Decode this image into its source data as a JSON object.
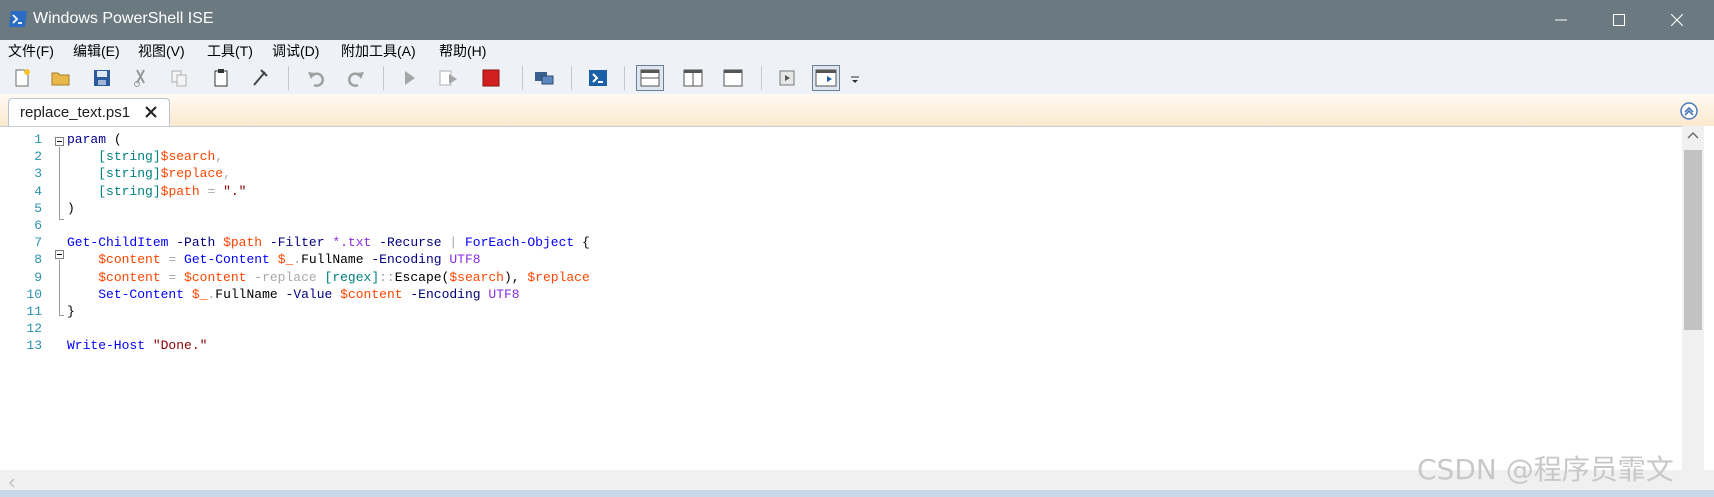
{
  "window": {
    "title": "Windows PowerShell ISE",
    "controls": [
      "minimize-icon",
      "maximize-icon",
      "close-icon"
    ]
  },
  "menu": {
    "items": [
      {
        "label": "文件(F)"
      },
      {
        "label": "编辑(E)"
      },
      {
        "label": "视图(V)"
      },
      {
        "label": "工具(T)"
      },
      {
        "label": "调试(D)"
      },
      {
        "label": "附加工具(A)"
      },
      {
        "label": "帮助(H)"
      }
    ]
  },
  "toolbar": {
    "buttons": [
      "new-file-icon",
      "open-folder-icon",
      "save-icon",
      "cut-icon",
      "copy-icon",
      "paste-icon",
      "clear-console-icon",
      "undo-icon",
      "redo-icon",
      "run-script-icon",
      "run-selection-icon",
      "stop-icon",
      "new-remote-tab-icon",
      "powershell-console-icon",
      "show-script-top-icon",
      "show-script-right-icon",
      "show-script-maximized-icon",
      "show-commands-icon",
      "show-addon-icon",
      "overflow-icon"
    ]
  },
  "tab": {
    "label": "replace_text.ps1"
  },
  "editor": {
    "lines": [
      {
        "n": "1",
        "tokens": [
          {
            "t": "param",
            "c": "kw"
          },
          {
            "t": " (",
            "c": "plain"
          }
        ]
      },
      {
        "n": "2",
        "tokens": [
          {
            "t": "    ",
            "c": "plain"
          },
          {
            "t": "[string]",
            "c": "type"
          },
          {
            "t": "$search",
            "c": "var"
          },
          {
            "t": ",",
            "c": "op"
          }
        ]
      },
      {
        "n": "3",
        "tokens": [
          {
            "t": "    ",
            "c": "plain"
          },
          {
            "t": "[string]",
            "c": "type"
          },
          {
            "t": "$replace",
            "c": "var"
          },
          {
            "t": ",",
            "c": "op"
          }
        ]
      },
      {
        "n": "4",
        "tokens": [
          {
            "t": "    ",
            "c": "plain"
          },
          {
            "t": "[string]",
            "c": "type"
          },
          {
            "t": "$path",
            "c": "var"
          },
          {
            "t": " = ",
            "c": "op"
          },
          {
            "t": "\".\"",
            "c": "str"
          }
        ]
      },
      {
        "n": "5",
        "tokens": [
          {
            "t": ")",
            "c": "plain"
          }
        ]
      },
      {
        "n": "6",
        "tokens": []
      },
      {
        "n": "7",
        "tokens": [
          {
            "t": "Get-ChildItem",
            "c": "cmd"
          },
          {
            "t": " ",
            "c": "plain"
          },
          {
            "t": "-Path",
            "c": "param"
          },
          {
            "t": " ",
            "c": "plain"
          },
          {
            "t": "$path",
            "c": "var"
          },
          {
            "t": " ",
            "c": "plain"
          },
          {
            "t": "-Filter",
            "c": "param"
          },
          {
            "t": " ",
            "c": "plain"
          },
          {
            "t": "*.txt",
            "c": "attr"
          },
          {
            "t": " ",
            "c": "plain"
          },
          {
            "t": "-Recurse",
            "c": "param"
          },
          {
            "t": " | ",
            "c": "op"
          },
          {
            "t": "ForEach-Object",
            "c": "cmd"
          },
          {
            "t": " {",
            "c": "plain"
          }
        ]
      },
      {
        "n": "8",
        "tokens": [
          {
            "t": "    ",
            "c": "plain"
          },
          {
            "t": "$content",
            "c": "var"
          },
          {
            "t": " = ",
            "c": "op"
          },
          {
            "t": "Get-Content",
            "c": "cmd"
          },
          {
            "t": " ",
            "c": "plain"
          },
          {
            "t": "$_",
            "c": "var"
          },
          {
            "t": ".",
            "c": "op"
          },
          {
            "t": "FullName",
            "c": "member"
          },
          {
            "t": " ",
            "c": "plain"
          },
          {
            "t": "-Encoding",
            "c": "param"
          },
          {
            "t": " ",
            "c": "plain"
          },
          {
            "t": "UTF8",
            "c": "attr"
          }
        ]
      },
      {
        "n": "9",
        "tokens": [
          {
            "t": "    ",
            "c": "plain"
          },
          {
            "t": "$content",
            "c": "var"
          },
          {
            "t": " = ",
            "c": "op"
          },
          {
            "t": "$content",
            "c": "var"
          },
          {
            "t": " ",
            "c": "plain"
          },
          {
            "t": "-replace",
            "c": "op"
          },
          {
            "t": " ",
            "c": "plain"
          },
          {
            "t": "[regex]",
            "c": "type"
          },
          {
            "t": "::",
            "c": "op"
          },
          {
            "t": "Escape",
            "c": "member"
          },
          {
            "t": "(",
            "c": "plain"
          },
          {
            "t": "$search",
            "c": "var"
          },
          {
            "t": "), ",
            "c": "plain"
          },
          {
            "t": "$replace",
            "c": "var"
          }
        ]
      },
      {
        "n": "10",
        "tokens": [
          {
            "t": "    ",
            "c": "plain"
          },
          {
            "t": "Set-Content",
            "c": "cmd"
          },
          {
            "t": " ",
            "c": "plain"
          },
          {
            "t": "$_",
            "c": "var"
          },
          {
            "t": ".",
            "c": "op"
          },
          {
            "t": "FullName",
            "c": "member"
          },
          {
            "t": " ",
            "c": "plain"
          },
          {
            "t": "-Value",
            "c": "param"
          },
          {
            "t": " ",
            "c": "plain"
          },
          {
            "t": "$content",
            "c": "var"
          },
          {
            "t": " ",
            "c": "plain"
          },
          {
            "t": "-Encoding",
            "c": "param"
          },
          {
            "t": " ",
            "c": "plain"
          },
          {
            "t": "UTF8",
            "c": "attr"
          }
        ]
      },
      {
        "n": "11",
        "tokens": [
          {
            "t": "}",
            "c": "plain"
          }
        ]
      },
      {
        "n": "12",
        "tokens": []
      },
      {
        "n": "13",
        "tokens": [
          {
            "t": "Write-Host",
            "c": "cmd"
          },
          {
            "t": " ",
            "c": "plain"
          },
          {
            "t": "\"Done.\"",
            "c": "str"
          }
        ]
      }
    ]
  },
  "watermark": "CSDN @程序员霏文",
  "colors": {
    "titlebar": "#6b7a80",
    "keyword": "#00008b",
    "variable": "#ff4500",
    "string": "#8b0000",
    "command": "#0000ff",
    "line_number": "#2b91af"
  }
}
